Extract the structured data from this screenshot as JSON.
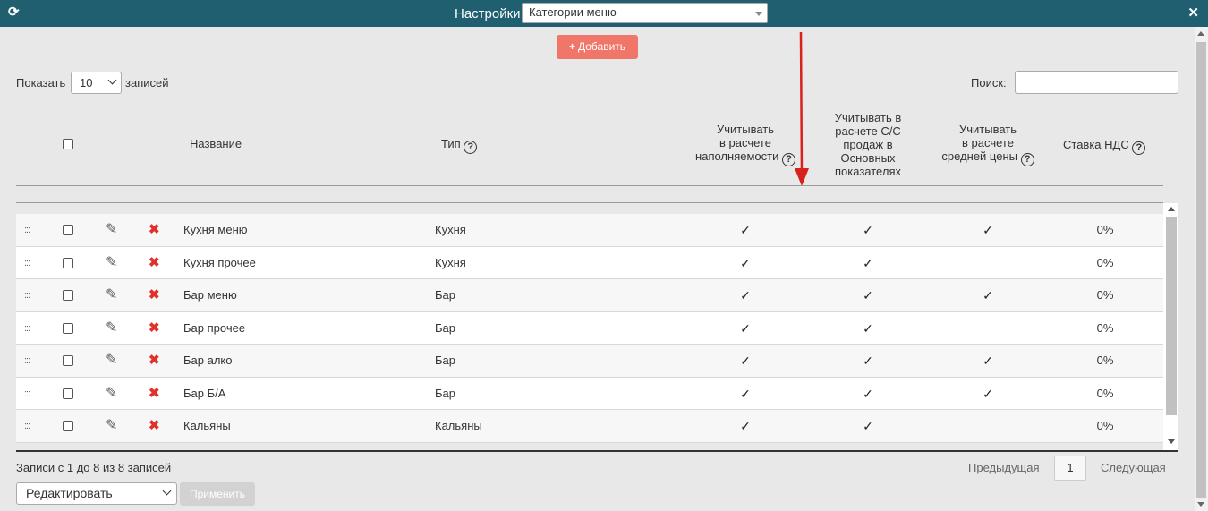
{
  "topbar": {
    "title": "Настройки",
    "section_select": "Категории меню",
    "refresh_icon": "refresh-icon",
    "close_icon": "close-icon"
  },
  "toolbar": {
    "add_label": "Добавить"
  },
  "controls": {
    "show_label": "Показать",
    "page_length": "10",
    "records_label": "записей",
    "search_label": "Поиск:",
    "search_value": ""
  },
  "table": {
    "headers": {
      "name": "Название",
      "type": "Тип",
      "fill_line1": "Учитывать",
      "fill_line2": "в расчете",
      "fill_line3": "наполняемости",
      "cost_line1": "Учитывать в",
      "cost_line2": "расчете С/С",
      "cost_line3": "продаж в",
      "cost_line4": "Основных",
      "cost_line5": "показателях",
      "avg_line1": "Учитывать",
      "avg_line2": "в расчете",
      "avg_line3": "средней цены",
      "vat": "Ставка НДС"
    },
    "rows": [
      {
        "name": "Кухня меню",
        "type": "Кухня",
        "fill": "✓",
        "cost": "✓",
        "avg": "✓",
        "vat": "0%"
      },
      {
        "name": "Кухня прочее",
        "type": "Кухня",
        "fill": "✓",
        "cost": "✓",
        "avg": "",
        "vat": "0%"
      },
      {
        "name": "Бар меню",
        "type": "Бар",
        "fill": "✓",
        "cost": "✓",
        "avg": "✓",
        "vat": "0%"
      },
      {
        "name": "Бар прочее",
        "type": "Бар",
        "fill": "✓",
        "cost": "✓",
        "avg": "",
        "vat": "0%"
      },
      {
        "name": "Бар алко",
        "type": "Бар",
        "fill": "✓",
        "cost": "✓",
        "avg": "✓",
        "vat": "0%"
      },
      {
        "name": "Бар Б/А",
        "type": "Бар",
        "fill": "✓",
        "cost": "✓",
        "avg": "✓",
        "vat": "0%"
      },
      {
        "name": "Кальяны",
        "type": "Кальяны",
        "fill": "✓",
        "cost": "✓",
        "avg": "",
        "vat": "0%"
      }
    ],
    "drag_handle": ":::",
    "edit_icon": "✎",
    "delete_icon": "✖",
    "help_icon": "?"
  },
  "footer": {
    "info": "Записи с 1 до 8 из 8 записей",
    "prev": "Предыдущая",
    "page": "1",
    "next": "Следующая",
    "bulk_action": "Редактировать",
    "apply": "Применить"
  },
  "colors": {
    "topbar": "#1f5f6f",
    "add_button": "#f0766a",
    "delete": "#e0312b",
    "annotation_arrow": "#d9201a"
  }
}
